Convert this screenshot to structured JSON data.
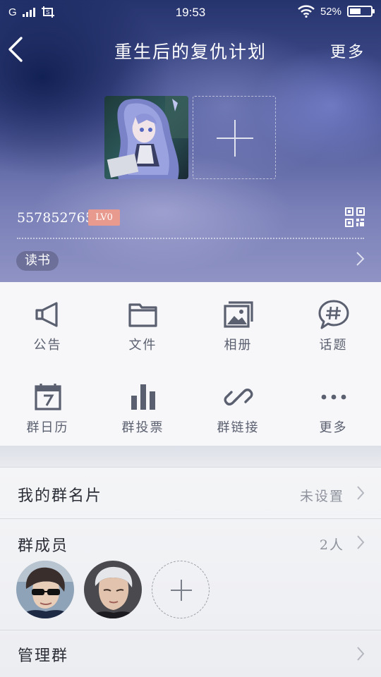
{
  "status_bar": {
    "carrier": "G",
    "time": "19:53",
    "battery_percent": "52%",
    "battery_level": 0.52
  },
  "nav": {
    "title": "重生后的复仇计划",
    "more_label": "更多"
  },
  "group": {
    "id": "557852765",
    "level_badge": "LV0",
    "tag": "读书"
  },
  "functions": [
    {
      "label": "公告",
      "icon": "megaphone-icon"
    },
    {
      "label": "文件",
      "icon": "folder-icon"
    },
    {
      "label": "相册",
      "icon": "photo-album-icon"
    },
    {
      "label": "话题",
      "icon": "hashtag-bubble-icon"
    },
    {
      "label": "群日历",
      "icon": "calendar-icon"
    },
    {
      "label": "群投票",
      "icon": "bar-chart-icon"
    },
    {
      "label": "群链接",
      "icon": "link-icon"
    },
    {
      "label": "更多",
      "icon": "more-dots-icon"
    }
  ],
  "my_card": {
    "label": "我的群名片",
    "value": "未设置"
  },
  "members": {
    "label": "群成员",
    "count": "2人"
  },
  "manage": {
    "label": "管理群"
  },
  "colors": {
    "badge": "#e89a8e",
    "icon": "#5b6070",
    "text_primary": "#2b2e36",
    "text_secondary": "#8e929c"
  }
}
